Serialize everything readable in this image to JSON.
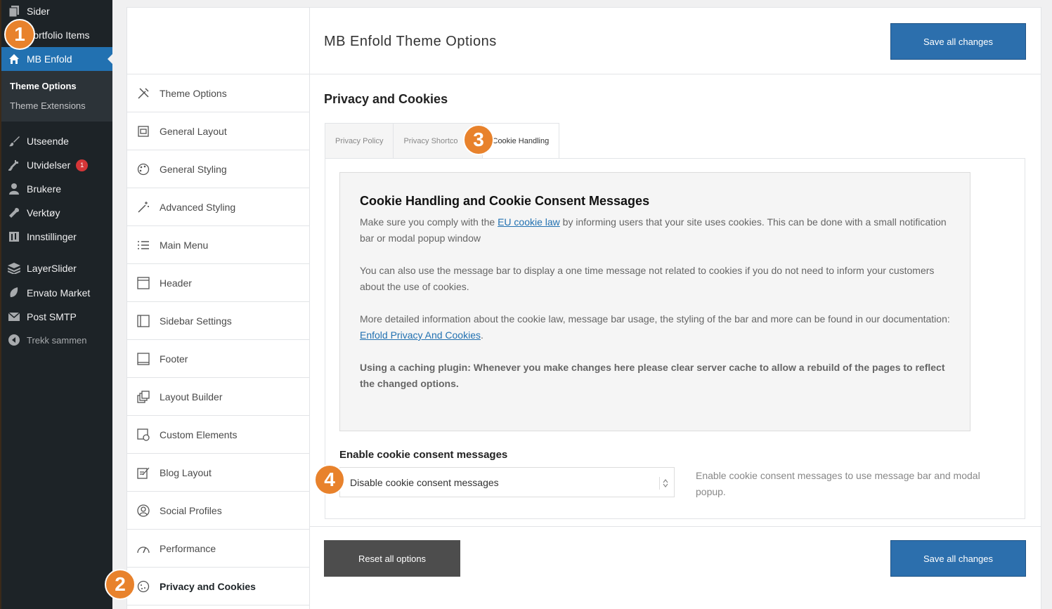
{
  "wp_menu": {
    "items": [
      {
        "label": "Sider",
        "icon": "pages-icon"
      },
      {
        "label": "Portfolio Items",
        "icon": "portfolio-icon"
      },
      {
        "label": "MB Enfold",
        "icon": "home-icon"
      },
      {
        "label": "Utseende",
        "icon": "paintbrush-icon"
      },
      {
        "label": "Utvidelser",
        "icon": "plugins-icon",
        "badge": "1"
      },
      {
        "label": "Brukere",
        "icon": "users-icon"
      },
      {
        "label": "Verktøy",
        "icon": "wrench-icon"
      },
      {
        "label": "Innstillinger",
        "icon": "settings-icon"
      },
      {
        "label": "LayerSlider",
        "icon": "layers-icon"
      },
      {
        "label": "Envato Market",
        "icon": "leaf-icon"
      },
      {
        "label": "Post SMTP",
        "icon": "mail-icon"
      },
      {
        "label": "Trekk sammen",
        "icon": "collapse-icon"
      }
    ],
    "submenu": [
      {
        "label": "Theme Options"
      },
      {
        "label": "Theme Extensions"
      }
    ]
  },
  "steps": [
    "1",
    "2",
    "3",
    "4"
  ],
  "options_sidebar": [
    {
      "label": "Theme Options",
      "icon": "tools-icon"
    },
    {
      "label": "General Layout",
      "icon": "layout-icon"
    },
    {
      "label": "General Styling",
      "icon": "palette-icon"
    },
    {
      "label": "Advanced Styling",
      "icon": "magic-wand-icon"
    },
    {
      "label": "Main Menu",
      "icon": "list-icon"
    },
    {
      "label": "Header",
      "icon": "header-icon"
    },
    {
      "label": "Sidebar Settings",
      "icon": "sidebar-icon"
    },
    {
      "label": "Footer",
      "icon": "footer-icon"
    },
    {
      "label": "Layout Builder",
      "icon": "builder-icon"
    },
    {
      "label": "Custom Elements",
      "icon": "custom-elements-icon"
    },
    {
      "label": "Blog Layout",
      "icon": "blog-icon"
    },
    {
      "label": "Social Profiles",
      "icon": "social-icon"
    },
    {
      "label": "Performance",
      "icon": "speedometer-icon"
    },
    {
      "label": "Privacy and Cookies",
      "icon": "cookie-icon"
    }
  ],
  "header": {
    "title": "MB Enfold Theme Options",
    "save_label": "Save all changes"
  },
  "section_title": "Privacy and Cookies",
  "tabs": [
    {
      "label": "Privacy Policy"
    },
    {
      "label": "Privacy Shortco"
    },
    {
      "label": "Cookie Handling"
    }
  ],
  "info": {
    "heading": "Cookie Handling and Cookie Consent Messages",
    "p1_before": "Make sure you comply with the ",
    "p1_link": "EU cookie law",
    "p1_after": " by informing users that your site uses cookies. This can be done with a small notification bar or modal popup window",
    "p2": "You can also use the message bar to display a one time message not related to cookies if you do not need to inform your customers about the use of cookies.",
    "p3": "More detailed information about the cookie law, message bar usage, the styling of the bar and more can be found in our documentation:",
    "p3_link": "Enfold Privacy And Cookies",
    "p4": "Using a caching plugin: Whenever you make changes here please clear server cache to allow a rebuild of the pages to reflect the changed options."
  },
  "field": {
    "label": "Enable cookie consent messages",
    "value": "Disable cookie consent messages",
    "description": "Enable cookie consent messages to use message bar and modal popup."
  },
  "footer": {
    "reset_label": "Reset all options",
    "save_label": "Save all changes"
  },
  "colors": {
    "accent": "#2271b1",
    "step_marker": "#e8822c",
    "save_button": "#2c6fad",
    "reset_button": "#4d4d4d",
    "admin_menu": "#1d2327"
  }
}
